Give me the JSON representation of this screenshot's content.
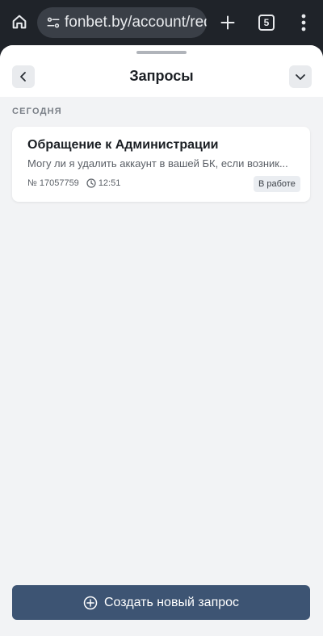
{
  "browser": {
    "url": "fonbet.by/account/requ",
    "tab_count": "5"
  },
  "sheet": {
    "title": "Запросы",
    "section_label": "СЕГОДНЯ",
    "requests": [
      {
        "title": "Обращение к Администрации",
        "preview": "Могу ли я удалить аккаунт в вашей БК, если возник...",
        "number": "№ 17057759",
        "time": "12:51",
        "status": "В работе"
      }
    ],
    "create_button_label": "Создать новый запрос"
  },
  "colors": {
    "browser_bg": "#1f2329",
    "sheet_bg": "#f2f3f5",
    "primary_button": "#3d5473",
    "status_badge_bg": "#eaedf1"
  },
  "icons": [
    "home-icon",
    "site-settings-icon",
    "plus-icon",
    "tabs-icon",
    "more-vert-icon",
    "chevron-left-icon",
    "chevron-down-icon",
    "clock-icon",
    "plus-circle-icon"
  ]
}
